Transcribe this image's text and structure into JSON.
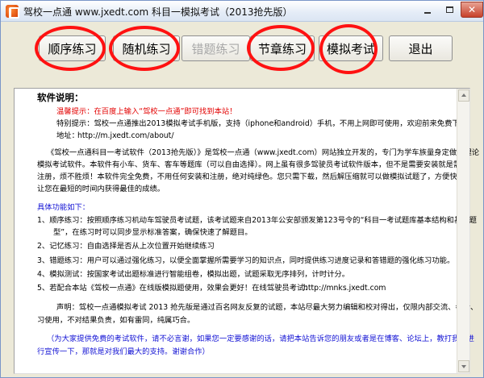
{
  "window": {
    "title": "驾校一点通 www.jxedt.com 科目一模拟考试（2013抢先版）",
    "close_glyph": "✕"
  },
  "toolbar": {
    "buttons": [
      {
        "label": "顺序练习",
        "enabled": true
      },
      {
        "label": "随机练习",
        "enabled": true
      },
      {
        "label": "错题练习",
        "enabled": false
      },
      {
        "label": "节章练习",
        "enabled": true
      },
      {
        "label": "模拟考试",
        "enabled": true
      },
      {
        "label": "退出",
        "enabled": true
      }
    ]
  },
  "panel": {
    "heading": "软件说明：",
    "tip": "温馨提示：在百度上输入“驾校一点通”即可找到本站！",
    "special_tip": "特别提示：驾校一点通推出2013模拟考试手机版，支持（iphone和android）手机，不用上网即可使用，欢迎前来免费下载！",
    "address_label": "地址：",
    "address_url": "http://m.jxedt.com/about/",
    "intro_lines": [
      "《驾校一点通科目一考试软件（2013抢先版）》是驾校一点通（www.jxedt.com）网站独立开发的，专门为学车族量身定做的理论",
      "模拟考试软件。本软件有小车、货车、客车等题库（可以自由选择）。网上虽有很多驾驶员考试软件版本，但不是需要安装就是需要",
      "注册，烦不胜烦！本软件完全免费，不用任何安装和注册，绝对纯绿色。您只需下载，然后解压缩就可以做模拟试题了，方便快捷，",
      "让您在最短的时间内获得最佳的成绩。"
    ],
    "features_heading": "具体功能如下：",
    "features": [
      "1、顺序练习：按照顺序练习机动车驾驶员考试题，该考试题来自2013年公安部颁发第123号令的“科目一考试题库基本结构和基本题",
      "型”，在练习时可以同步显示标准答案，确保快速了解题目。",
      "2、记忆练习：自由选择是否从上次位置开始继续练习",
      "3、错题练习：用户可以通过强化练习，以便全面掌握所需要学习的知识点，同时提供练习进度记录和答错题的强化练习功能。",
      "4、模拟测试：按国家考试出题标准进行智能组卷，模拟出题，试题采取无序排列，计时计分。",
      "5、若配合本站《驾校一点通》在线版模拟题使用，效果会更好！在线驾驶员考试："
    ],
    "online_url": "http://mnks.jxedt.com",
    "statement_lines": [
      "声明：驾校一点通模拟考试 2013 抢先版是通过百名网友反复的试题，本站尽最大努力编辑和校对得出，仅限内部交流、参考、",
      "习使用，不对结果负责，如有雷同，纯属巧合。"
    ],
    "closing_lines": [
      "（为大家提供免费的考试软件，请不必言谢，如果您一定要感谢的话，请把本站告诉您的朋友或者是在博客、论坛上，教打我们进",
      "行宣传一下，那就是对我们最大的支持。谢谢合作）"
    ]
  },
  "colors": {
    "tip_red": "#e30000",
    "feature_blue": "#1212d4",
    "annotation_circle": "#ff1111",
    "window_bg": "#ece9d8"
  }
}
